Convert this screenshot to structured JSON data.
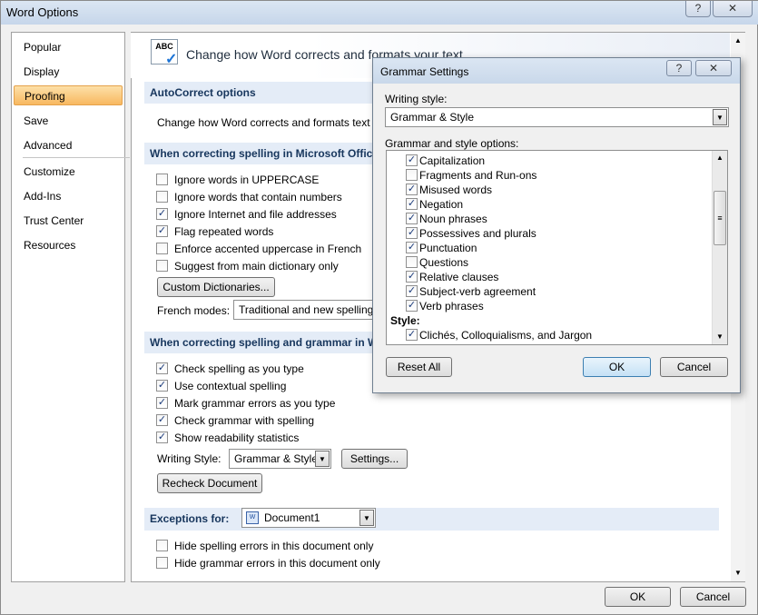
{
  "window": {
    "title": "Word Options",
    "help_glyph": "?",
    "close_glyph": "✕"
  },
  "nav": {
    "items": [
      "Popular",
      "Display",
      "Proofing",
      "Save",
      "Advanced",
      "Customize",
      "Add-Ins",
      "Trust Center",
      "Resources"
    ],
    "active": "Proofing"
  },
  "banner": {
    "text": "Change how Word corrects and formats your text.",
    "icon_text": "ABC"
  },
  "autocorrect": {
    "heading": "AutoCorrect options",
    "description": "Change how Word corrects and formats text a"
  },
  "office_spelling": {
    "heading": "When correcting spelling in Microsoft Office pro",
    "options": [
      {
        "label": "Ignore words in UPPERCASE",
        "checked": false
      },
      {
        "label": "Ignore words that contain numbers",
        "checked": false
      },
      {
        "label": "Ignore Internet and file addresses",
        "checked": true
      },
      {
        "label": "Flag repeated words",
        "checked": true
      },
      {
        "label": "Enforce accented uppercase in French",
        "checked": false
      },
      {
        "label": "Suggest from main dictionary only",
        "checked": false
      }
    ],
    "custom_dictionaries_label": "Custom Dictionaries...",
    "french_modes_label": "French modes:",
    "french_modes_value": "Traditional and new spelling"
  },
  "word_spelling": {
    "heading": "When correcting spelling and grammar in Word",
    "options": [
      {
        "label": "Check spelling as you type",
        "checked": true
      },
      {
        "label": "Use contextual spelling",
        "checked": true
      },
      {
        "label": "Mark grammar errors as you type",
        "checked": true
      },
      {
        "label": "Check grammar with spelling",
        "checked": true
      },
      {
        "label": "Show readability statistics",
        "checked": true
      }
    ],
    "writing_style_label": "Writing Style:",
    "writing_style_value": "Grammar & Style",
    "settings_label": "Settings...",
    "recheck_label": "Recheck Document"
  },
  "exceptions": {
    "label": "Exceptions for:",
    "document": "Document1",
    "options": [
      {
        "label": "Hide spelling errors in this document only",
        "checked": false
      },
      {
        "label": "Hide grammar errors in this document only",
        "checked": false
      }
    ]
  },
  "footer": {
    "ok_label": "OK",
    "cancel_label": "Cancel"
  },
  "grammar_dialog": {
    "title": "Grammar Settings",
    "help_glyph": "?",
    "close_glyph": "✕",
    "writing_style_label": "Writing style:",
    "writing_style_value": "Grammar & Style",
    "options_label": "Grammar and style options:",
    "items": [
      {
        "label": "Capitalization",
        "checked": true
      },
      {
        "label": "Fragments and Run-ons",
        "checked": false
      },
      {
        "label": "Misused words",
        "checked": true
      },
      {
        "label": "Negation",
        "checked": true
      },
      {
        "label": "Noun phrases",
        "checked": true
      },
      {
        "label": "Possessives and plurals",
        "checked": true
      },
      {
        "label": "Punctuation",
        "checked": true
      },
      {
        "label": "Questions",
        "checked": false
      },
      {
        "label": "Relative clauses",
        "checked": true
      },
      {
        "label": "Subject-verb agreement",
        "checked": true
      },
      {
        "label": "Verb phrases",
        "checked": true
      }
    ],
    "style_heading": "Style:",
    "style_items": [
      {
        "label": "Clichés, Colloquialisms, and Jargon",
        "checked": true
      }
    ],
    "reset_label": "Reset All",
    "ok_label": "OK",
    "cancel_label": "Cancel"
  },
  "glyphs": {
    "check": "✓",
    "down_arrow": "▼",
    "up_arrow": "▲",
    "scroll_grip": "≡"
  }
}
